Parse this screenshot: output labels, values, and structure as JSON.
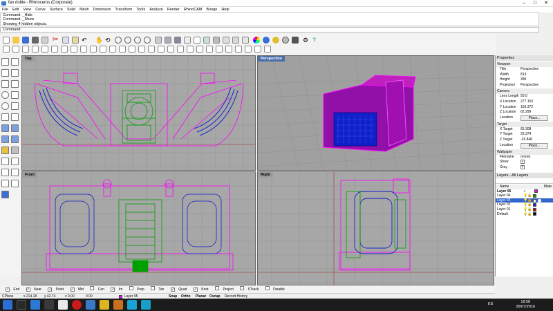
{
  "window": {
    "title": "fan doble - Rhinoceros (Corporate)"
  },
  "menu": [
    "File",
    "Edit",
    "View",
    "Curve",
    "Surface",
    "Solid",
    "Mesh",
    "Dimension",
    "Transform",
    "Tools",
    "Analyze",
    "Render",
    "RhinoCAM",
    "Bongo",
    "Help"
  ],
  "command_history": [
    "Command: _Hide",
    "Command: _Show",
    "Showing 4 hidden objects."
  ],
  "command_prompt": "Command:",
  "viewports": {
    "top": "Top",
    "perspective": "Perspective",
    "front": "Front",
    "right": "Right"
  },
  "properties": {
    "title": "Properties",
    "viewport_section": "Viewport",
    "rows": [
      {
        "k": "Title",
        "v": "Perspective"
      },
      {
        "k": "Width",
        "v": "813"
      },
      {
        "k": "Height",
        "v": "395"
      },
      {
        "k": "Projection",
        "v": "Perspective"
      }
    ],
    "camera_section": "Camera",
    "camera_rows": [
      {
        "k": "Lens Length",
        "v": "50.0"
      },
      {
        "k": "X Location",
        "v": "277.153"
      },
      {
        "k": "Y Location",
        "v": "159.372"
      },
      {
        "k": "Z Location",
        "v": "62.299"
      }
    ],
    "location_label": "Location",
    "place_label": "Place...",
    "target_section": "Target",
    "target_rows": [
      {
        "k": "X Target",
        "v": "65.308"
      },
      {
        "k": "Y Target",
        "v": "23.374"
      },
      {
        "k": "Z Target",
        "v": "-26.848"
      }
    ],
    "wallpaper_section": "Wallpaper",
    "wallpaper_rows": [
      {
        "k": "Filename",
        "v": "(none)"
      },
      {
        "k": "Show",
        "v": ""
      },
      {
        "k": "Gray",
        "v": ""
      }
    ]
  },
  "layers": {
    "title": "Layers - All Layers",
    "col_name": "Name",
    "col_material": "Mate",
    "rows": [
      {
        "name": "Layer 05",
        "color": "#ff00ff",
        "current": true,
        "selected": false
      },
      {
        "name": "Layer 04",
        "color": "#00aa00",
        "current": false,
        "selected": false
      },
      {
        "name": "Layer 03",
        "color": "#ffffff",
        "current": false,
        "selected": true
      },
      {
        "name": "Layer 02",
        "color": "#2222cc",
        "current": false,
        "selected": false
      },
      {
        "name": "Layer 01",
        "color": "#cc0000",
        "current": false,
        "selected": false
      },
      {
        "name": "Default",
        "color": "#000000",
        "current": false,
        "selected": false
      }
    ]
  },
  "osnap": [
    "End",
    "Near",
    "Point",
    "Mid",
    "Cen",
    "Int",
    "Perp",
    "Tan",
    "Quad",
    "Knot",
    "Project",
    "STrack",
    "Disable"
  ],
  "osnap_checked": [
    true,
    true,
    true,
    true,
    false,
    true,
    false,
    false,
    true,
    true,
    false,
    false,
    false
  ],
  "status": {
    "cplane": "CPlane",
    "x": "x 214.18",
    "y": "y 42.74",
    "z": "z 0.00",
    "units": "0.00",
    "layer": "Layer 05",
    "snap": "Snap",
    "ortho": "Ortho",
    "planar": "Planar",
    "osnap": "Osnap",
    "record": "Record History"
  },
  "taskbar": {
    "lang": "ES",
    "time": "18:58",
    "date": "26/07/2016"
  },
  "colors": {
    "magenta": "#ff00ff",
    "green": "#00a000",
    "blue": "#1020c8",
    "viewport_bg": "#a7a7a7",
    "active_title": "#4a6ea9"
  }
}
